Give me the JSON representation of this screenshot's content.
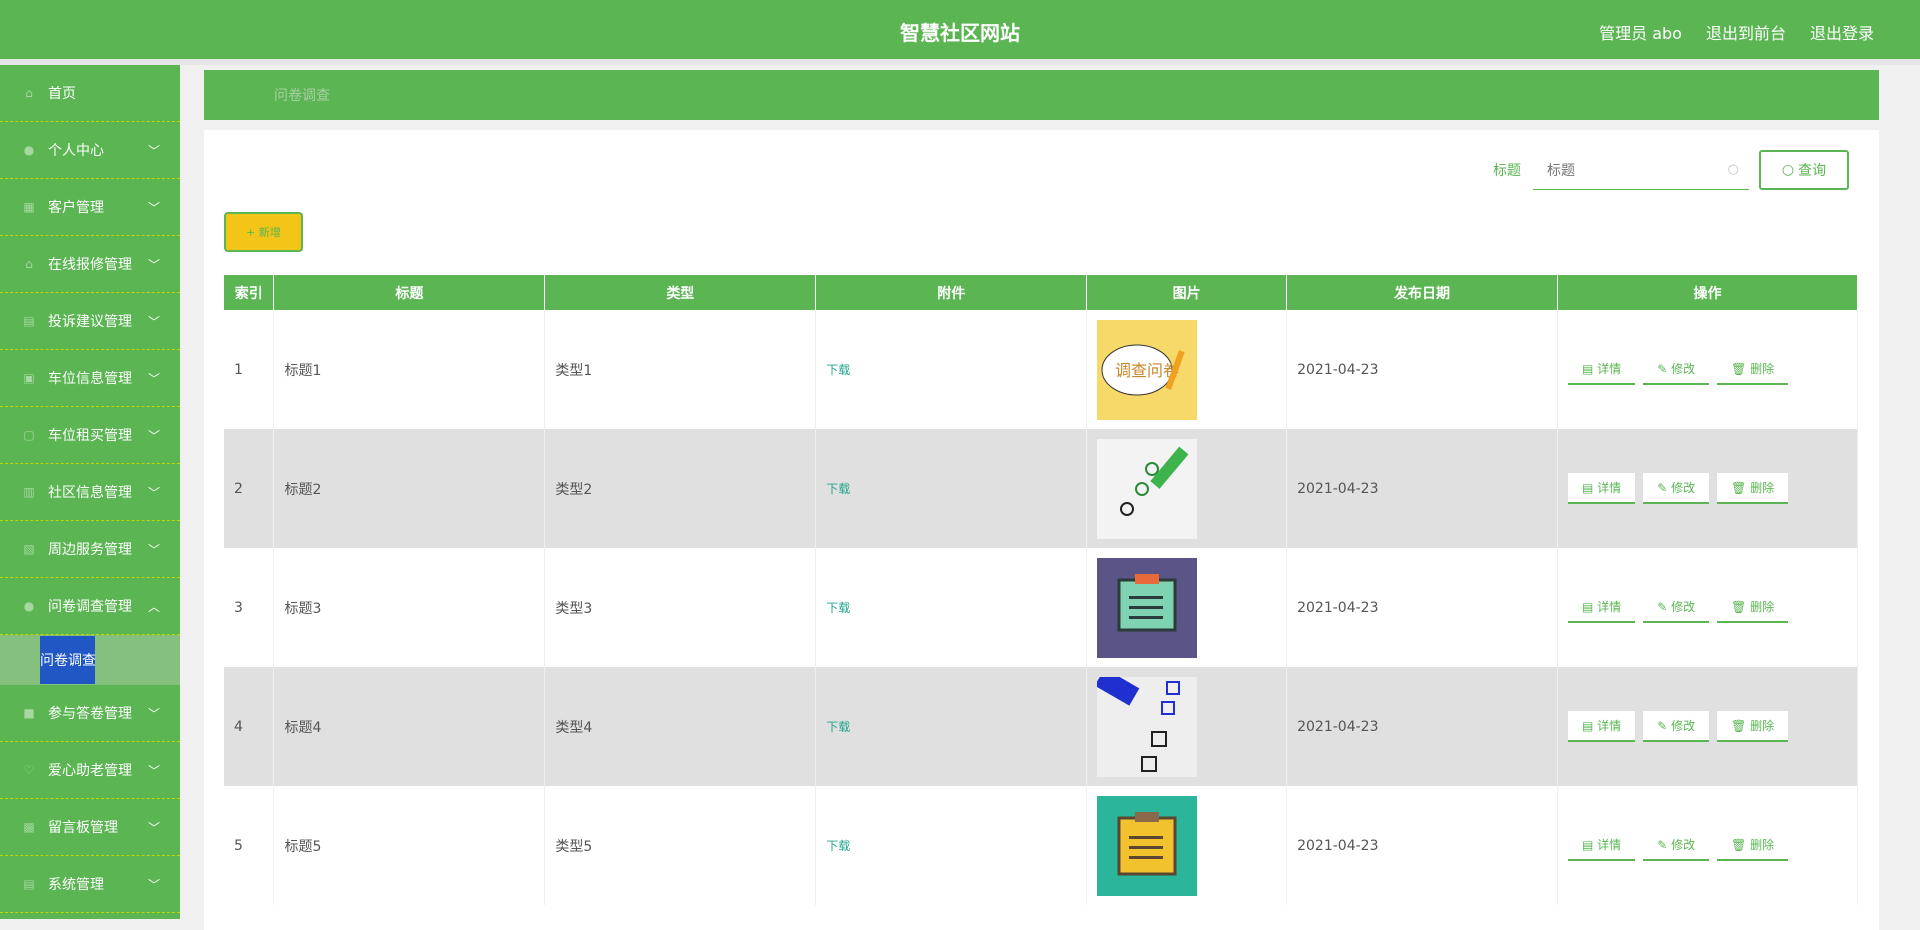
{
  "topbar": {
    "title": "智慧社区网站",
    "user": "管理员 abo",
    "to_front": "退出到前台",
    "logout": "退出登录"
  },
  "sidebar": {
    "items": [
      {
        "label": "首页",
        "icon": "home-icon"
      },
      {
        "label": "个人中心",
        "icon": "user-icon"
      },
      {
        "label": "客户管理",
        "icon": "grid-icon"
      },
      {
        "label": "在线报修管理",
        "icon": "tools-icon"
      },
      {
        "label": "投诉建议管理",
        "icon": "message-icon"
      },
      {
        "label": "车位信息管理",
        "icon": "car-icon"
      },
      {
        "label": "车位租买管理",
        "icon": "doc-icon"
      },
      {
        "label": "社区信息管理",
        "icon": "info-icon"
      },
      {
        "label": "周边服务管理",
        "icon": "service-icon"
      },
      {
        "label": "问卷调查管理",
        "icon": "survey-icon"
      },
      {
        "label": "参与答卷管理",
        "icon": "answer-icon"
      },
      {
        "label": "爱心助老管理",
        "icon": "heart-icon"
      },
      {
        "label": "留言板管理",
        "icon": "comment-icon"
      },
      {
        "label": "系统管理",
        "icon": "settings-icon"
      }
    ],
    "submenu_active": "问卷调查"
  },
  "breadcrumb": "问卷调查",
  "search": {
    "label": "标题",
    "placeholder": "标题",
    "button": "查询"
  },
  "add_button": "+ 新增",
  "table": {
    "headers": [
      "索引",
      "标题",
      "类型",
      "附件",
      "图片",
      "发布日期",
      "操作"
    ],
    "rows": [
      {
        "index": "1",
        "title": "标题1",
        "type": "类型1",
        "attachment": "下载",
        "date": "2021-04-23",
        "image": "survey-cartoon"
      },
      {
        "index": "2",
        "title": "标题2",
        "type": "类型2",
        "attachment": "下载",
        "date": "2021-04-23",
        "image": "checklist-pencil"
      },
      {
        "index": "3",
        "title": "标题3",
        "type": "类型3",
        "attachment": "下载",
        "date": "2021-04-23",
        "image": "clipboard-purple"
      },
      {
        "index": "4",
        "title": "标题4",
        "type": "类型4",
        "attachment": "下载",
        "date": "2021-04-23",
        "image": "checklist-blue"
      },
      {
        "index": "5",
        "title": "标题5",
        "type": "类型5",
        "attachment": "下载",
        "date": "2021-04-23",
        "image": "clipboard-teal"
      }
    ],
    "actions": {
      "detail": "详情",
      "edit": "修改",
      "delete": "删除"
    }
  }
}
